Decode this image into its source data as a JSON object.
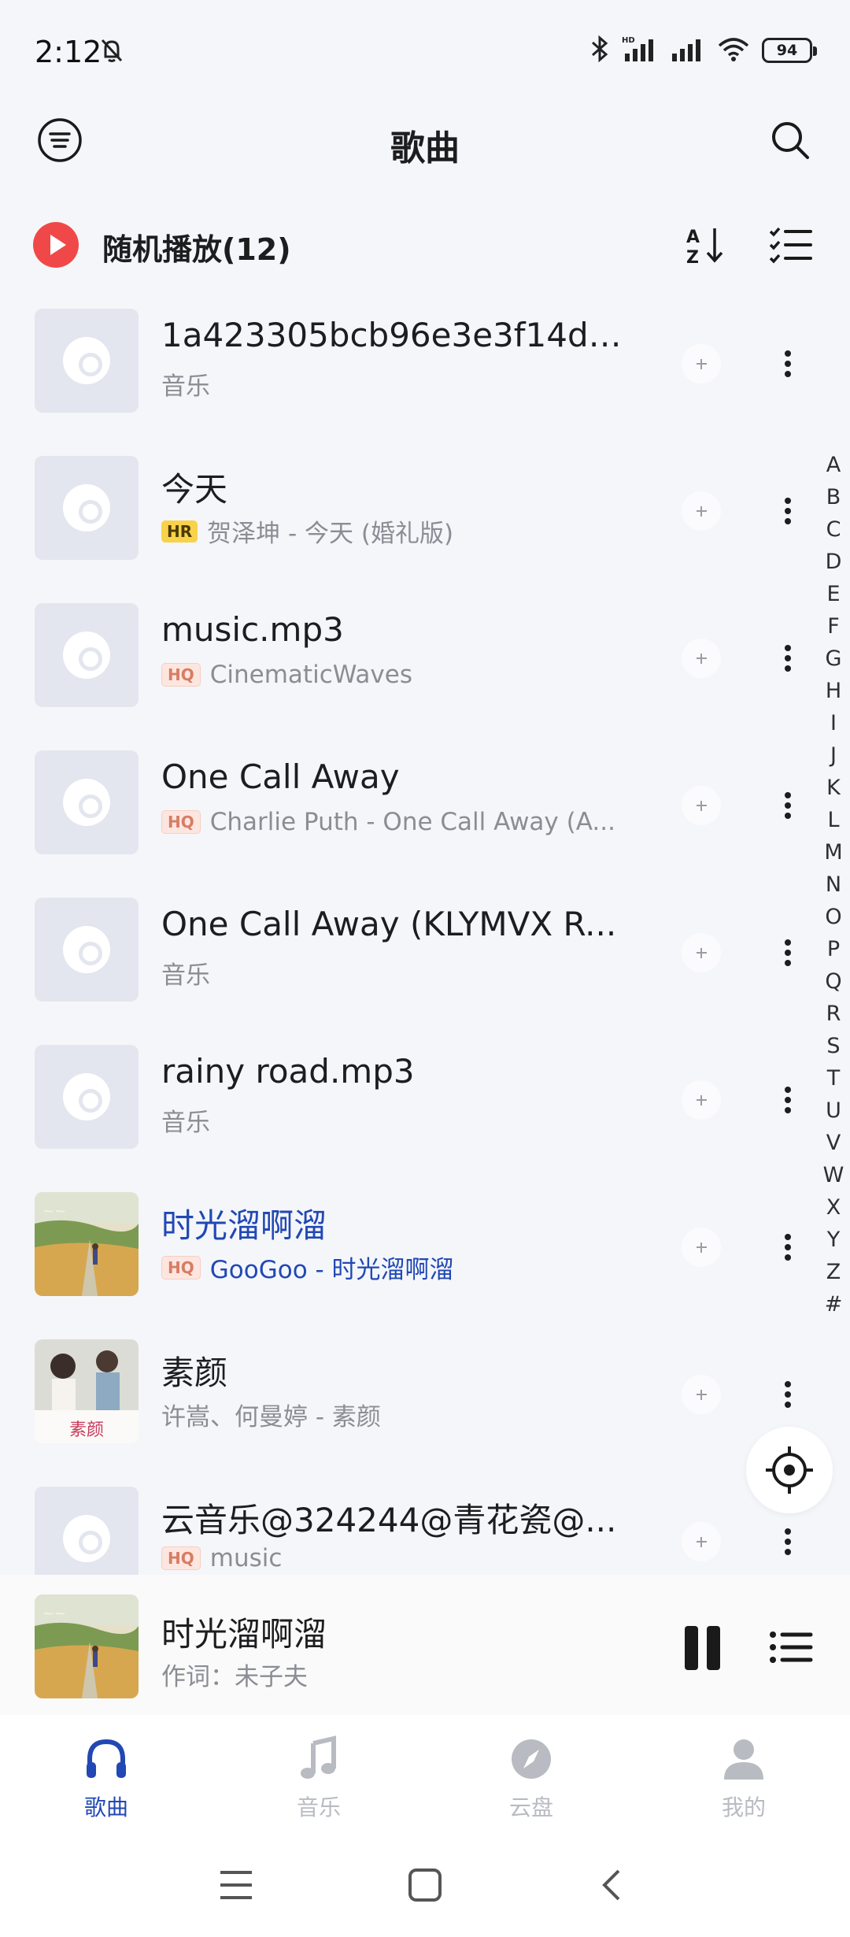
{
  "status": {
    "time": "2:12",
    "battery": "94"
  },
  "header": {
    "title": "歌曲"
  },
  "shuffle": {
    "label": "随机播放(12)"
  },
  "songs": [
    {
      "title": "1a423305bcb96e3e3f14dc...",
      "badge": "",
      "subtitle": "音乐",
      "cover": "placeholder",
      "playing": false
    },
    {
      "title": "今天",
      "badge": "HR",
      "subtitle": "贺泽坤 - 今天 (婚礼版)",
      "cover": "placeholder",
      "playing": false
    },
    {
      "title": "music.mp3",
      "badge": "HQ",
      "subtitle": "CinematicWaves",
      "cover": "placeholder",
      "playing": false
    },
    {
      "title": "One Call Away",
      "badge": "HQ",
      "subtitle": "Charlie Puth - One Call Away (A...",
      "cover": "placeholder",
      "playing": false
    },
    {
      "title": "One Call Away (KLYMVX R...",
      "badge": "",
      "subtitle": "音乐",
      "cover": "placeholder",
      "playing": false
    },
    {
      "title": "rainy road.mp3",
      "badge": "",
      "subtitle": "音乐",
      "cover": "placeholder",
      "playing": false
    },
    {
      "title": "时光溜啊溜",
      "badge": "HQ",
      "subtitle": "GooGoo - 时光溜啊溜",
      "cover": "album-art-field",
      "playing": true
    },
    {
      "title": "素颜",
      "badge": "",
      "subtitle": "许嵩、何曼婷 - 素颜",
      "cover": "album-art-portrait",
      "playing": false
    },
    {
      "title": "云音乐@324244@青花瓷@...",
      "badge": "HQ",
      "subtitle": "music",
      "cover": "placeholder",
      "playing": false
    }
  ],
  "index_letters": [
    "A",
    "B",
    "C",
    "D",
    "E",
    "F",
    "G",
    "H",
    "I",
    "J",
    "K",
    "L",
    "M",
    "N",
    "O",
    "P",
    "Q",
    "R",
    "S",
    "T",
    "U",
    "V",
    "W",
    "X",
    "Y",
    "Z",
    "#"
  ],
  "now_playing": {
    "title": "时光溜啊溜",
    "subtitle": "作词：未子夫"
  },
  "album_art_text": {
    "portrait_title": "素颜"
  },
  "nav": [
    {
      "label": "歌曲",
      "icon": "headphones-icon",
      "active": true
    },
    {
      "label": "音乐",
      "icon": "music-note-icon",
      "active": false
    },
    {
      "label": "云盘",
      "icon": "compass-icon",
      "active": false
    },
    {
      "label": "我的",
      "icon": "person-icon",
      "active": false
    }
  ],
  "colors": {
    "accent": "#2148b4",
    "shuffle": "#f04848",
    "background": "#f4f6fa"
  }
}
